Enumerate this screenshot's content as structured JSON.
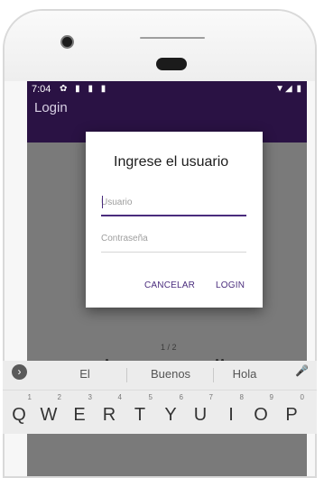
{
  "status_bar": {
    "time": "7:04",
    "icons_left": "✿ ▮ ▮ ▮",
    "icons_right": "▼◢ ▮"
  },
  "app_bar": {
    "title": "Login"
  },
  "dialog": {
    "title": "Ingrese el usuario",
    "username_placeholder": "Usuario",
    "password_placeholder": "Contraseña",
    "cancel_label": "CANCELAR",
    "login_label": "LOGIN"
  },
  "pager": {
    "text": "1 / 2"
  },
  "keyboard": {
    "suggestions": [
      "El",
      "Buenos",
      "Hola"
    ],
    "expand_icon": "›",
    "mic_icon": "🎤",
    "keys": [
      {
        "letter": "Q",
        "hint": "1"
      },
      {
        "letter": "W",
        "hint": "2"
      },
      {
        "letter": "E",
        "hint": "3"
      },
      {
        "letter": "R",
        "hint": "4"
      },
      {
        "letter": "T",
        "hint": "5"
      },
      {
        "letter": "Y",
        "hint": "6"
      },
      {
        "letter": "U",
        "hint": "7"
      },
      {
        "letter": "I",
        "hint": "8"
      },
      {
        "letter": "O",
        "hint": "9"
      },
      {
        "letter": "P",
        "hint": "0"
      }
    ]
  },
  "colors": {
    "accent": "#4a2c7d",
    "app_bar": "#2a1244",
    "scrim": "#7a7a7a"
  }
}
